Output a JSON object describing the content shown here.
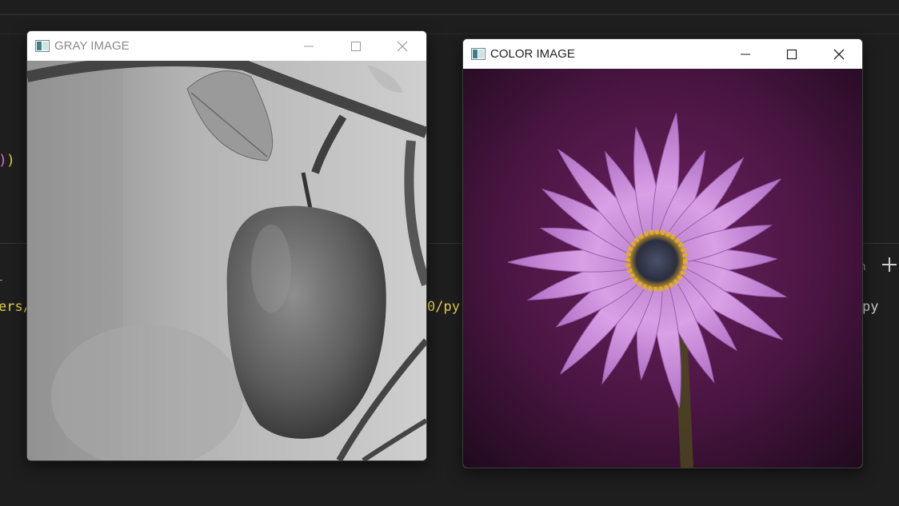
{
  "background": {
    "code_fragment": ")",
    "code_fragment_2": ")",
    "terminal_left": "ers/",
    "terminal_mid": "0/py",
    "terminal_right": "py",
    "terminal_label": "n"
  },
  "windows": {
    "gray": {
      "title": "GRAY IMAGE",
      "title_color": "#8a8a8a",
      "image_icon": "grayscale-apple-image"
    },
    "color": {
      "title": "COLOR IMAGE",
      "title_color": "#222222",
      "image_icon": "purple-daisy-image"
    }
  },
  "icons": {
    "minimize": "minimize-icon",
    "maximize": "maximize-icon",
    "close": "close-icon",
    "new_terminal": "plus-icon"
  },
  "colors": {
    "editor_bg": "#1e1e1e",
    "terminal_yellow": "#e5d24a",
    "flower_bg": "#3a0f33",
    "petal": "#c98bd8"
  }
}
